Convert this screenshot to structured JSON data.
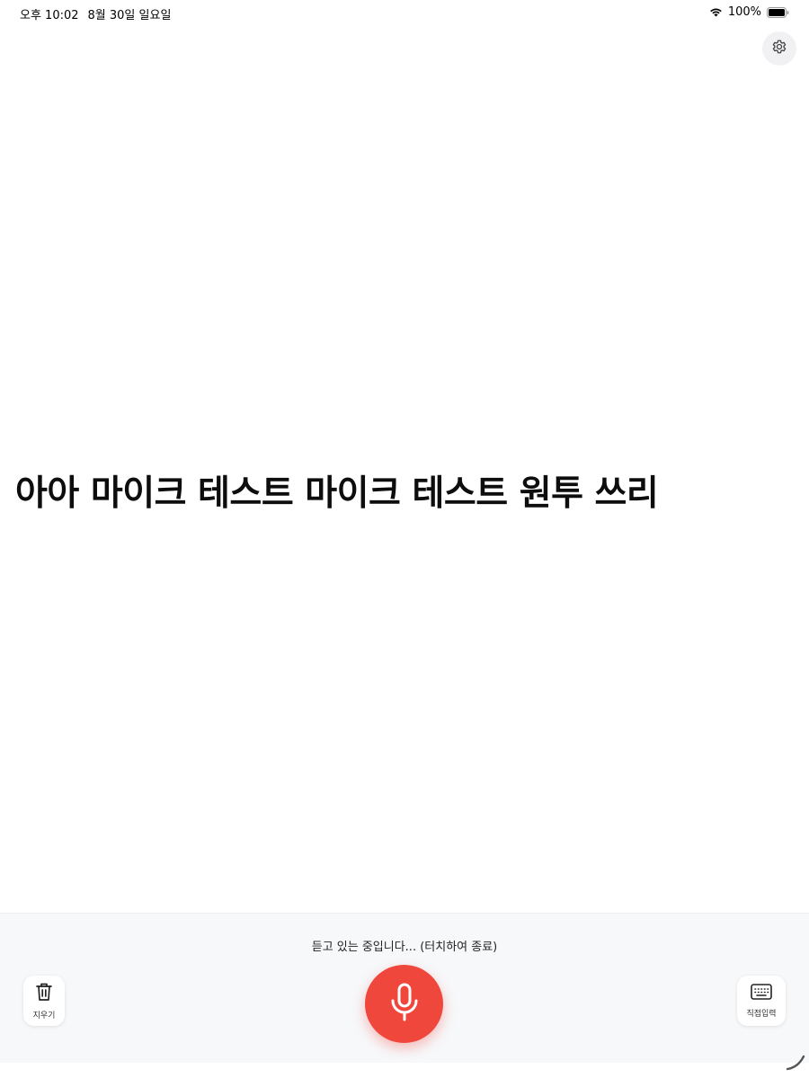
{
  "status_bar": {
    "time": "오후 10:02",
    "date": "8월 30일 일요일",
    "battery_percent": "100%",
    "wifi_icon": "wifi-icon",
    "battery_icon": "battery-icon",
    "battery_level": 1.0
  },
  "settings": {
    "icon": "gear-icon"
  },
  "transcript": {
    "text": "아아 마이크 테스트 마이크 테스트 원투 쓰리"
  },
  "bottom_panel": {
    "status_text": "듣고 있는 중입니다... (터치하여 종료)",
    "clear_button": {
      "label": "지우기",
      "icon": "trash-icon"
    },
    "mic_button": {
      "icon": "microphone-icon",
      "color": "#f0473d"
    },
    "keyboard_button": {
      "label": "직접입력",
      "icon": "keyboard-icon"
    }
  },
  "colors": {
    "accent": "#f0473d",
    "panel_background": "#f7f8fa",
    "background": "#ffffff"
  }
}
